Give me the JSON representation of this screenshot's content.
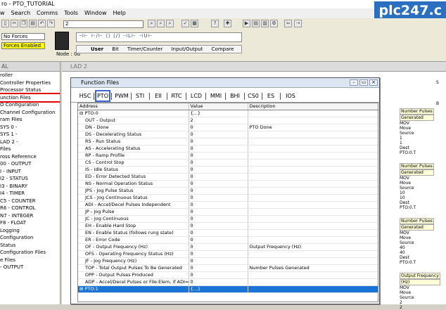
{
  "window": {
    "title": "ro - PTO_TUTORIAL"
  },
  "brand": "plc247.c",
  "menu": [
    "w",
    "Search",
    "Comms",
    "Tools",
    "Window",
    "Help"
  ],
  "toolbar": {
    "address_box": "2",
    "forces1": "No Forces",
    "forces2": "Forces Enabled",
    "node": "Node : 0d",
    "instr_tabs": [
      "User",
      "Bit",
      "Timer/Counter",
      "Input/Output",
      "Compare"
    ]
  },
  "left_pane": {
    "header": "AL",
    "items": [
      "roller",
      "Controller Properties",
      "Processor Status",
      "unction Files",
      "O Configuration",
      "Channel Configuration",
      "ram Files",
      "SYS 0 -",
      "SYS 1 -",
      "LAD 2 -",
      "Files",
      "ross Reference",
      "00 - OUTPUT",
      "I - INPUT",
      "I2 - STATUS",
      "I3 - BINARY",
      "I4 - TIMER",
      "C5 - COUNTER",
      "R6 - CONTROL",
      "N7 - INTEGER",
      "F8 - FLOAT",
      "Logging",
      "Configuration",
      "Status",
      "Configuration Files",
      "e Files",
      "- OUTPUT"
    ],
    "highlighted_index": 3
  },
  "ladder": {
    "title": "LAD 2",
    "rungs": [
      {
        "label1": "Number Pulses",
        "label2": "Generated",
        "instr": "MOV",
        "move": "Move",
        "source": "Source",
        "dest": "Dest",
        "dest_val": "PTO:0.T",
        "vals": [
          "1",
          "1"
        ]
      },
      {
        "label1": "Number Pulses",
        "label2": "Generated",
        "instr": "MOV",
        "move": "Move",
        "source": "Source",
        "dest": "Dest",
        "dest_val": "PTO:0.T",
        "vals": [
          "10",
          "10"
        ]
      },
      {
        "label1": "Number Pulses",
        "label2": "Generated",
        "instr": "MOV",
        "move": "Move",
        "source": "Source",
        "dest": "Dest",
        "dest_val": "PTO:0.T",
        "vals": [
          "40",
          "40"
        ]
      },
      {
        "label1": "Output Frequency",
        "label2": "(Hz)",
        "instr": "MOV",
        "move": "Move",
        "source": "Source",
        "dest": "",
        "dest_val": "",
        "vals": [
          "2",
          "2"
        ]
      }
    ],
    "top_right": [
      "S",
      "B"
    ]
  },
  "dialog": {
    "title": "Function Files",
    "tabs": [
      "HSC",
      "PTO",
      "PWM",
      "STI",
      "EII",
      "RTC",
      "LCD",
      "MMI",
      "BHI",
      "CS0",
      "ES",
      "IOS"
    ],
    "active_tab": "PTO",
    "columns": [
      "Address",
      "Value",
      "Description"
    ],
    "rows": [
      {
        "address": "⊟ PTO:0",
        "value": "{...}",
        "description": ""
      },
      {
        "address": "OUT - Output",
        "value": "2",
        "description": ""
      },
      {
        "address": "DN - Done",
        "value": "0",
        "description": "PTO Done"
      },
      {
        "address": "DS - Decelerating Status",
        "value": "0",
        "description": ""
      },
      {
        "address": "RS - Run Status",
        "value": "0",
        "description": ""
      },
      {
        "address": "AS - Accelerating Status",
        "value": "0",
        "description": ""
      },
      {
        "address": "RP - Ramp Profile",
        "value": "0",
        "description": ""
      },
      {
        "address": "CS - Control Stop",
        "value": "0",
        "description": ""
      },
      {
        "address": "IS - Idle Status",
        "value": "0",
        "description": ""
      },
      {
        "address": "ED - Error Detected Status",
        "value": "0",
        "description": ""
      },
      {
        "address": "NS - Normal Operation Status",
        "value": "0",
        "description": ""
      },
      {
        "address": "JPS - Jog Pulse Status",
        "value": "0",
        "description": ""
      },
      {
        "address": "JCS - Jog Continuous Status",
        "value": "0",
        "description": ""
      },
      {
        "address": "ADI - Accel/Decel Pulses Independent",
        "value": "0",
        "description": ""
      },
      {
        "address": "JP - Jog Pulse",
        "value": "0",
        "description": ""
      },
      {
        "address": "JC - Jog Continuous",
        "value": "0",
        "description": ""
      },
      {
        "address": "EH - Enable Hard Stop",
        "value": "0",
        "description": ""
      },
      {
        "address": "EN - Enable Status (follows rung state)",
        "value": "0",
        "description": ""
      },
      {
        "address": "ER - Error Code",
        "value": "0",
        "description": ""
      },
      {
        "address": "OF - Output Frequency (Hz)",
        "value": "0",
        "description": "Output Frequency (Hz)"
      },
      {
        "address": "OFS - Operating Frequency Status (Hz)",
        "value": "0",
        "description": ""
      },
      {
        "address": "JF - Jog Frequency (Hz)",
        "value": "0",
        "description": ""
      },
      {
        "address": "TOP - Total Output Pulses To Be Generated",
        "value": "0",
        "description": "Number Pulses Generated"
      },
      {
        "address": "OPP - Output Pulses Produced",
        "value": "0",
        "description": ""
      },
      {
        "address": "ADP - Accel/Decel Pulses or File:Elem, if ADI=1",
        "value": "0",
        "description": ""
      },
      {
        "address": "⊞ PTO:1",
        "value": "{...}",
        "description": ""
      }
    ],
    "selected_row": 25
  },
  "colors": {
    "brand_bg": "#2b6fc1",
    "highlight_red": "#e00000",
    "selection_blue": "#1a74d6",
    "tab_outline": "#3a64d8"
  }
}
